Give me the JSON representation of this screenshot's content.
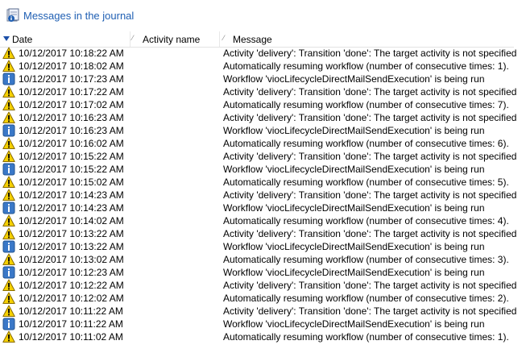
{
  "toolbar": {
    "title": "Messages in the journal",
    "icon": "journal-icon"
  },
  "columns": [
    {
      "label": "Date",
      "sorted": "descending"
    },
    {
      "label": "Activity name"
    },
    {
      "label": "Message"
    }
  ],
  "rows": [
    {
      "level": "warning",
      "date": "10/12/2017 10:18:22 AM",
      "activity": "",
      "message": "Activity 'delivery': Transition 'done': The target activity is not specified"
    },
    {
      "level": "warning",
      "date": "10/12/2017 10:18:02 AM",
      "activity": "",
      "message": "Automatically resuming workflow (number of consecutive times: 1)."
    },
    {
      "level": "info",
      "date": "10/12/2017 10:17:23 AM",
      "activity": "",
      "message": "Workflow 'viocLifecycleDirectMailSendExecution' is being run"
    },
    {
      "level": "warning",
      "date": "10/12/2017 10:17:22 AM",
      "activity": "",
      "message": "Activity 'delivery': Transition 'done': The target activity is not specified"
    },
    {
      "level": "warning",
      "date": "10/12/2017 10:17:02 AM",
      "activity": "",
      "message": "Automatically resuming workflow (number of consecutive times: 7)."
    },
    {
      "level": "warning",
      "date": "10/12/2017 10:16:23 AM",
      "activity": "",
      "message": "Activity 'delivery': Transition 'done': The target activity is not specified"
    },
    {
      "level": "info",
      "date": "10/12/2017 10:16:23 AM",
      "activity": "",
      "message": "Workflow 'viocLifecycleDirectMailSendExecution' is being run"
    },
    {
      "level": "warning",
      "date": "10/12/2017 10:16:02 AM",
      "activity": "",
      "message": "Automatically resuming workflow (number of consecutive times: 6)."
    },
    {
      "level": "warning",
      "date": "10/12/2017 10:15:22 AM",
      "activity": "",
      "message": "Activity 'delivery': Transition 'done': The target activity is not specified"
    },
    {
      "level": "info",
      "date": "10/12/2017 10:15:22 AM",
      "activity": "",
      "message": "Workflow 'viocLifecycleDirectMailSendExecution' is being run"
    },
    {
      "level": "warning",
      "date": "10/12/2017 10:15:02 AM",
      "activity": "",
      "message": "Automatically resuming workflow (number of consecutive times: 5)."
    },
    {
      "level": "warning",
      "date": "10/12/2017 10:14:23 AM",
      "activity": "",
      "message": "Activity 'delivery': Transition 'done': The target activity is not specified"
    },
    {
      "level": "info",
      "date": "10/12/2017 10:14:23 AM",
      "activity": "",
      "message": "Workflow 'viocLifecycleDirectMailSendExecution' is being run"
    },
    {
      "level": "warning",
      "date": "10/12/2017 10:14:02 AM",
      "activity": "",
      "message": "Automatically resuming workflow (number of consecutive times: 4)."
    },
    {
      "level": "warning",
      "date": "10/12/2017 10:13:22 AM",
      "activity": "",
      "message": "Activity 'delivery': Transition 'done': The target activity is not specified"
    },
    {
      "level": "info",
      "date": "10/12/2017 10:13:22 AM",
      "activity": "",
      "message": "Workflow 'viocLifecycleDirectMailSendExecution' is being run"
    },
    {
      "level": "warning",
      "date": "10/12/2017 10:13:02 AM",
      "activity": "",
      "message": "Automatically resuming workflow (number of consecutive times: 3)."
    },
    {
      "level": "info",
      "date": "10/12/2017 10:12:23 AM",
      "activity": "",
      "message": "Workflow 'viocLifecycleDirectMailSendExecution' is being run"
    },
    {
      "level": "warning",
      "date": "10/12/2017 10:12:22 AM",
      "activity": "",
      "message": "Activity 'delivery': Transition 'done': The target activity is not specified"
    },
    {
      "level": "warning",
      "date": "10/12/2017 10:12:02 AM",
      "activity": "",
      "message": "Automatically resuming workflow (number of consecutive times: 2)."
    },
    {
      "level": "warning",
      "date": "10/12/2017 10:11:22 AM",
      "activity": "",
      "message": "Activity 'delivery': Transition 'done': The target activity is not specified"
    },
    {
      "level": "info",
      "date": "10/12/2017 10:11:22 AM",
      "activity": "",
      "message": "Workflow 'viocLifecycleDirectMailSendExecution' is being run"
    },
    {
      "level": "warning",
      "date": "10/12/2017 10:11:02 AM",
      "activity": "",
      "message": "Automatically resuming workflow (number of consecutive times: 1)."
    }
  ]
}
